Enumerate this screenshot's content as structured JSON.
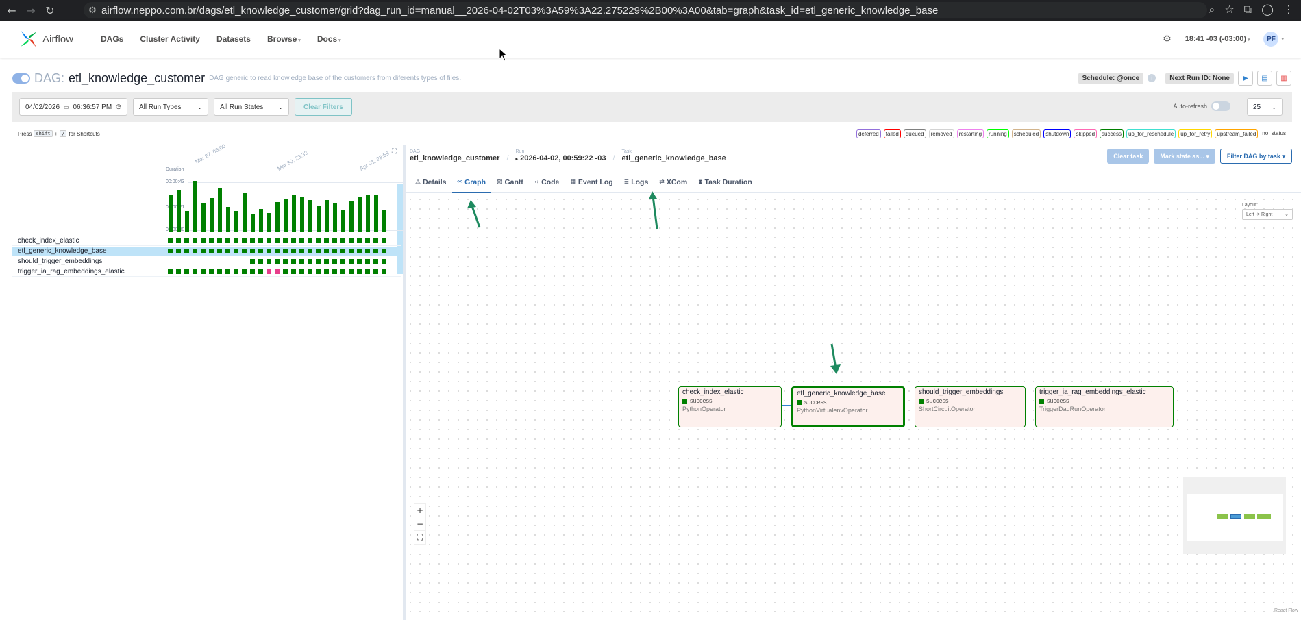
{
  "browser": {
    "url": "airflow.neppo.com.br/dags/etl_knowledge_customer/grid?dag_run_id=manual__2026-04-02T03%3A59%3A22.275229%2B00%3A00&tab=graph&task_id=etl_generic_knowledge_base"
  },
  "nav": {
    "brand": "Airflow",
    "links": [
      "DAGs",
      "Cluster Activity",
      "Datasets",
      "Browse",
      "Docs"
    ],
    "time": "18:41 -03 (-03:00)",
    "user_initials": "PF"
  },
  "dag": {
    "prefix": "DAG:",
    "id": "etl_knowledge_customer",
    "description": "DAG generic to read knowledge base of the customers from diferents types of files.",
    "schedule": "Schedule: @once",
    "next_run": "Next Run ID: None"
  },
  "filters": {
    "date": "04/02/2026",
    "time": "06:36:57 PM",
    "run_types": "All Run Types",
    "run_states": "All Run States",
    "clear": "Clear Filters",
    "auto_refresh": "Auto-refresh",
    "page_size": "25"
  },
  "shortcuts": {
    "press": "Press",
    "key1": "shift",
    "plus": "+",
    "key2": "/",
    "suffix": "for Shortcuts"
  },
  "legend": [
    {
      "label": "deferred",
      "color": "#9370db"
    },
    {
      "label": "failed",
      "color": "#ff0000"
    },
    {
      "label": "queued",
      "color": "#808080"
    },
    {
      "label": "removed",
      "color": "#d3d3d3"
    },
    {
      "label": "restarting",
      "color": "#ee82ee"
    },
    {
      "label": "running",
      "color": "#00ff00"
    },
    {
      "label": "scheduled",
      "color": "#d2b48c"
    },
    {
      "label": "shutdown",
      "color": "#0000ff"
    },
    {
      "label": "skipped",
      "color": "#ff69b4"
    },
    {
      "label": "success",
      "color": "#008000"
    },
    {
      "label": "up_for_reschedule",
      "color": "#40e0d0"
    },
    {
      "label": "up_for_retry",
      "color": "#ffd700"
    },
    {
      "label": "upstream_failed",
      "color": "#ffa500"
    },
    {
      "label": "no_status",
      "color": "#ffffff"
    }
  ],
  "grid": {
    "duration_label": "Duration",
    "y_ticks": [
      "00:00:43",
      "00:00:21",
      "00:00:00"
    ],
    "x_labels": [
      "Mar 27, 03:00",
      "Mar 30, 23:32",
      "Apr 01, 23:59"
    ],
    "durations": [
      0.72,
      0.82,
      0.4,
      1.0,
      0.55,
      0.66,
      0.85,
      0.48,
      0.4,
      0.75,
      0.35,
      0.45,
      0.36,
      0.58,
      0.65,
      0.72,
      0.68,
      0.62,
      0.5,
      0.62,
      0.55,
      0.42,
      0.6,
      0.68,
      0.72,
      0.72,
      0.42
    ],
    "tasks": [
      {
        "name": "check_index_elastic",
        "pink": []
      },
      {
        "name": "etl_generic_knowledge_base",
        "pink": []
      },
      {
        "name": "should_trigger_embeddings",
        "pink": [],
        "start": 10
      },
      {
        "name": "trigger_ia_rag_embeddings_elastic",
        "pink": [
          12,
          13
        ]
      }
    ]
  },
  "details": {
    "crumb_dag_label": "DAG",
    "crumb_dag": "etl_knowledge_customer",
    "crumb_run_label": "Run",
    "crumb_run": "2026-04-02, 00:59:22 -03",
    "crumb_task_label": "Task",
    "crumb_task": "etl_generic_knowledge_base",
    "clear_task": "Clear task",
    "mark_state": "Mark state as...",
    "filter_dag": "Filter DAG by task",
    "tabs": [
      "Details",
      "Graph",
      "Gantt",
      "Code",
      "Event Log",
      "Logs",
      "XCom",
      "Task Duration"
    ]
  },
  "graph": {
    "layout_label": "Layout:",
    "layout_value": "Left -> Right",
    "nodes": [
      {
        "id": "check_index_elastic",
        "state": "success",
        "operator": "PythonOperator"
      },
      {
        "id": "etl_generic_knowledge_base",
        "state": "success",
        "operator": "PythonVirtualenvOperator"
      },
      {
        "id": "should_trigger_embeddings",
        "state": "success",
        "operator": "ShortCircuitOperator"
      },
      {
        "id": "trigger_ia_rag_embeddings_elastic",
        "state": "success",
        "operator": "TriggerDagRunOperator"
      }
    ],
    "attribution": "React Flow"
  },
  "colors": {
    "success": "#008000",
    "accent": "#2b6cb0",
    "annotation": "#1e8a5f"
  }
}
